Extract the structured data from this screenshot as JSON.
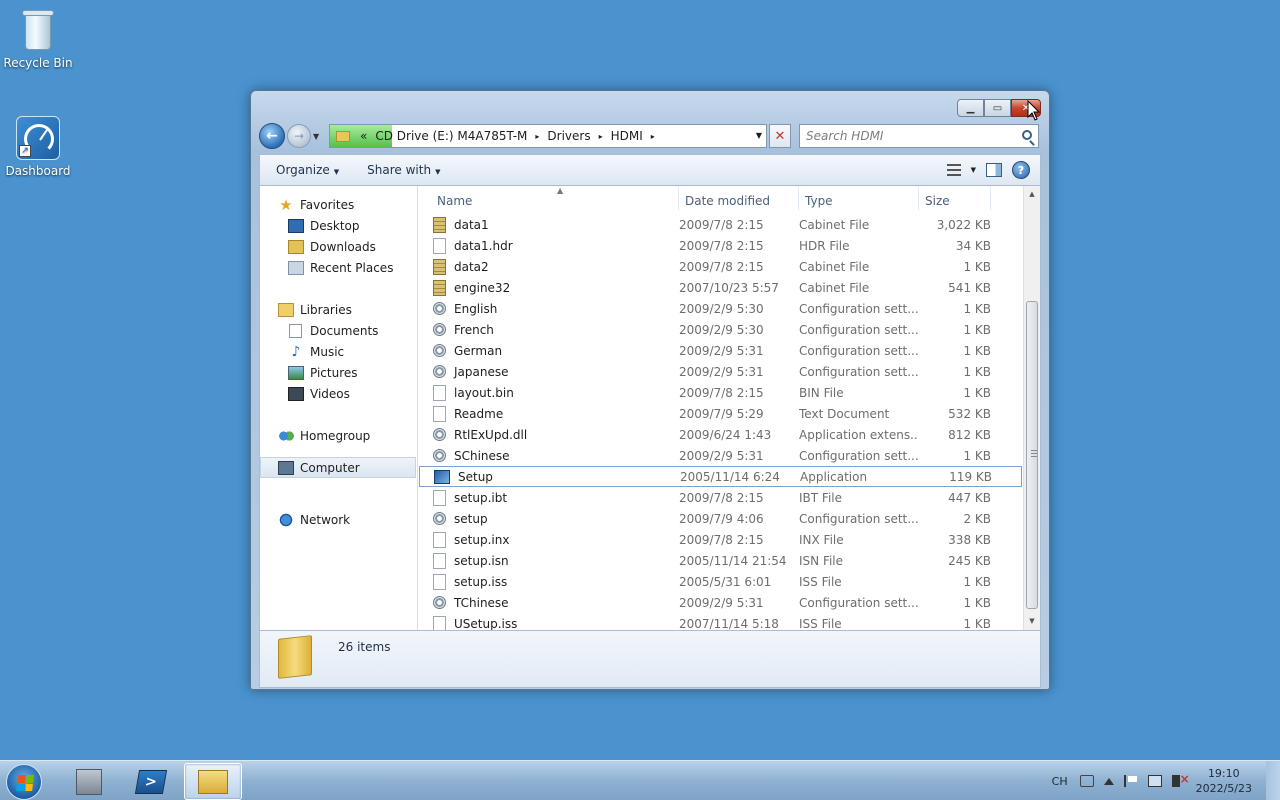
{
  "desktop": {
    "icons": [
      {
        "label": "Recycle Bin",
        "icon": "recycle-bin-icon"
      },
      {
        "label": "Dashboard",
        "icon": "dashboard-icon"
      }
    ]
  },
  "window": {
    "address": {
      "overflow": "«",
      "crumbs": [
        "CD Drive (E:) M4A785T-M",
        "Drivers",
        "HDMI"
      ],
      "separator": "▸"
    },
    "search": {
      "placeholder": "Search HDMI"
    },
    "toolbar": {
      "organize": "Organize",
      "share": "Share with"
    },
    "nav": {
      "favorites": "Favorites",
      "desktop": "Desktop",
      "downloads": "Downloads",
      "recent": "Recent Places",
      "libraries": "Libraries",
      "documents": "Documents",
      "music": "Music",
      "pictures": "Pictures",
      "videos": "Videos",
      "homegroup": "Homegroup",
      "computer": "Computer",
      "network": "Network"
    },
    "columns": {
      "name": "Name",
      "date": "Date modified",
      "type": "Type",
      "size": "Size"
    },
    "files": [
      {
        "name": "data1",
        "date": "2009/7/8 2:15",
        "type": "Cabinet File",
        "size": "3,022 KB",
        "icon": "cab"
      },
      {
        "name": "data1.hdr",
        "date": "2009/7/8 2:15",
        "type": "HDR File",
        "size": "34 KB",
        "icon": "file"
      },
      {
        "name": "data2",
        "date": "2009/7/8 2:15",
        "type": "Cabinet File",
        "size": "1 KB",
        "icon": "cab"
      },
      {
        "name": "engine32",
        "date": "2007/10/23 5:57",
        "type": "Cabinet File",
        "size": "541 KB",
        "icon": "cab"
      },
      {
        "name": "English",
        "date": "2009/2/9 5:30",
        "type": "Configuration sett...",
        "size": "1 KB",
        "icon": "cfg"
      },
      {
        "name": "French",
        "date": "2009/2/9 5:30",
        "type": "Configuration sett...",
        "size": "1 KB",
        "icon": "cfg"
      },
      {
        "name": "German",
        "date": "2009/2/9 5:31",
        "type": "Configuration sett...",
        "size": "1 KB",
        "icon": "cfg"
      },
      {
        "name": "Japanese",
        "date": "2009/2/9 5:31",
        "type": "Configuration sett...",
        "size": "1 KB",
        "icon": "cfg"
      },
      {
        "name": "layout.bin",
        "date": "2009/7/8 2:15",
        "type": "BIN File",
        "size": "1 KB",
        "icon": "file"
      },
      {
        "name": "Readme",
        "date": "2009/7/9 5:29",
        "type": "Text Document",
        "size": "532 KB",
        "icon": "file"
      },
      {
        "name": "RtlExUpd.dll",
        "date": "2009/6/24 1:43",
        "type": "Application extens...",
        "size": "812 KB",
        "icon": "cfg"
      },
      {
        "name": "SChinese",
        "date": "2009/2/9 5:31",
        "type": "Configuration sett...",
        "size": "1 KB",
        "icon": "cfg"
      },
      {
        "name": "Setup",
        "date": "2005/11/14 6:24",
        "type": "Application",
        "size": "119 KB",
        "icon": "app",
        "selected": true
      },
      {
        "name": "setup.ibt",
        "date": "2009/7/8 2:15",
        "type": "IBT File",
        "size": "447 KB",
        "icon": "file"
      },
      {
        "name": "setup",
        "date": "2009/7/9 4:06",
        "type": "Configuration sett...",
        "size": "2 KB",
        "icon": "cfg"
      },
      {
        "name": "setup.inx",
        "date": "2009/7/8 2:15",
        "type": "INX File",
        "size": "338 KB",
        "icon": "file"
      },
      {
        "name": "setup.isn",
        "date": "2005/11/14 21:54",
        "type": "ISN File",
        "size": "245 KB",
        "icon": "file"
      },
      {
        "name": "setup.iss",
        "date": "2005/5/31 6:01",
        "type": "ISS File",
        "size": "1 KB",
        "icon": "file"
      },
      {
        "name": "TChinese",
        "date": "2009/2/9 5:31",
        "type": "Configuration sett...",
        "size": "1 KB",
        "icon": "cfg"
      },
      {
        "name": "USetup.iss",
        "date": "2007/11/14 5:18",
        "type": "ISS File",
        "size": "1 KB",
        "icon": "file"
      }
    ],
    "status": {
      "count": "26 items"
    }
  },
  "taskbar": {
    "language": "CH",
    "time": "19:10",
    "date": "2022/5/23"
  },
  "colors": {
    "desktop": "#4a93cf",
    "selection_border": "#7da2ce",
    "close_button": "#c6452c"
  }
}
